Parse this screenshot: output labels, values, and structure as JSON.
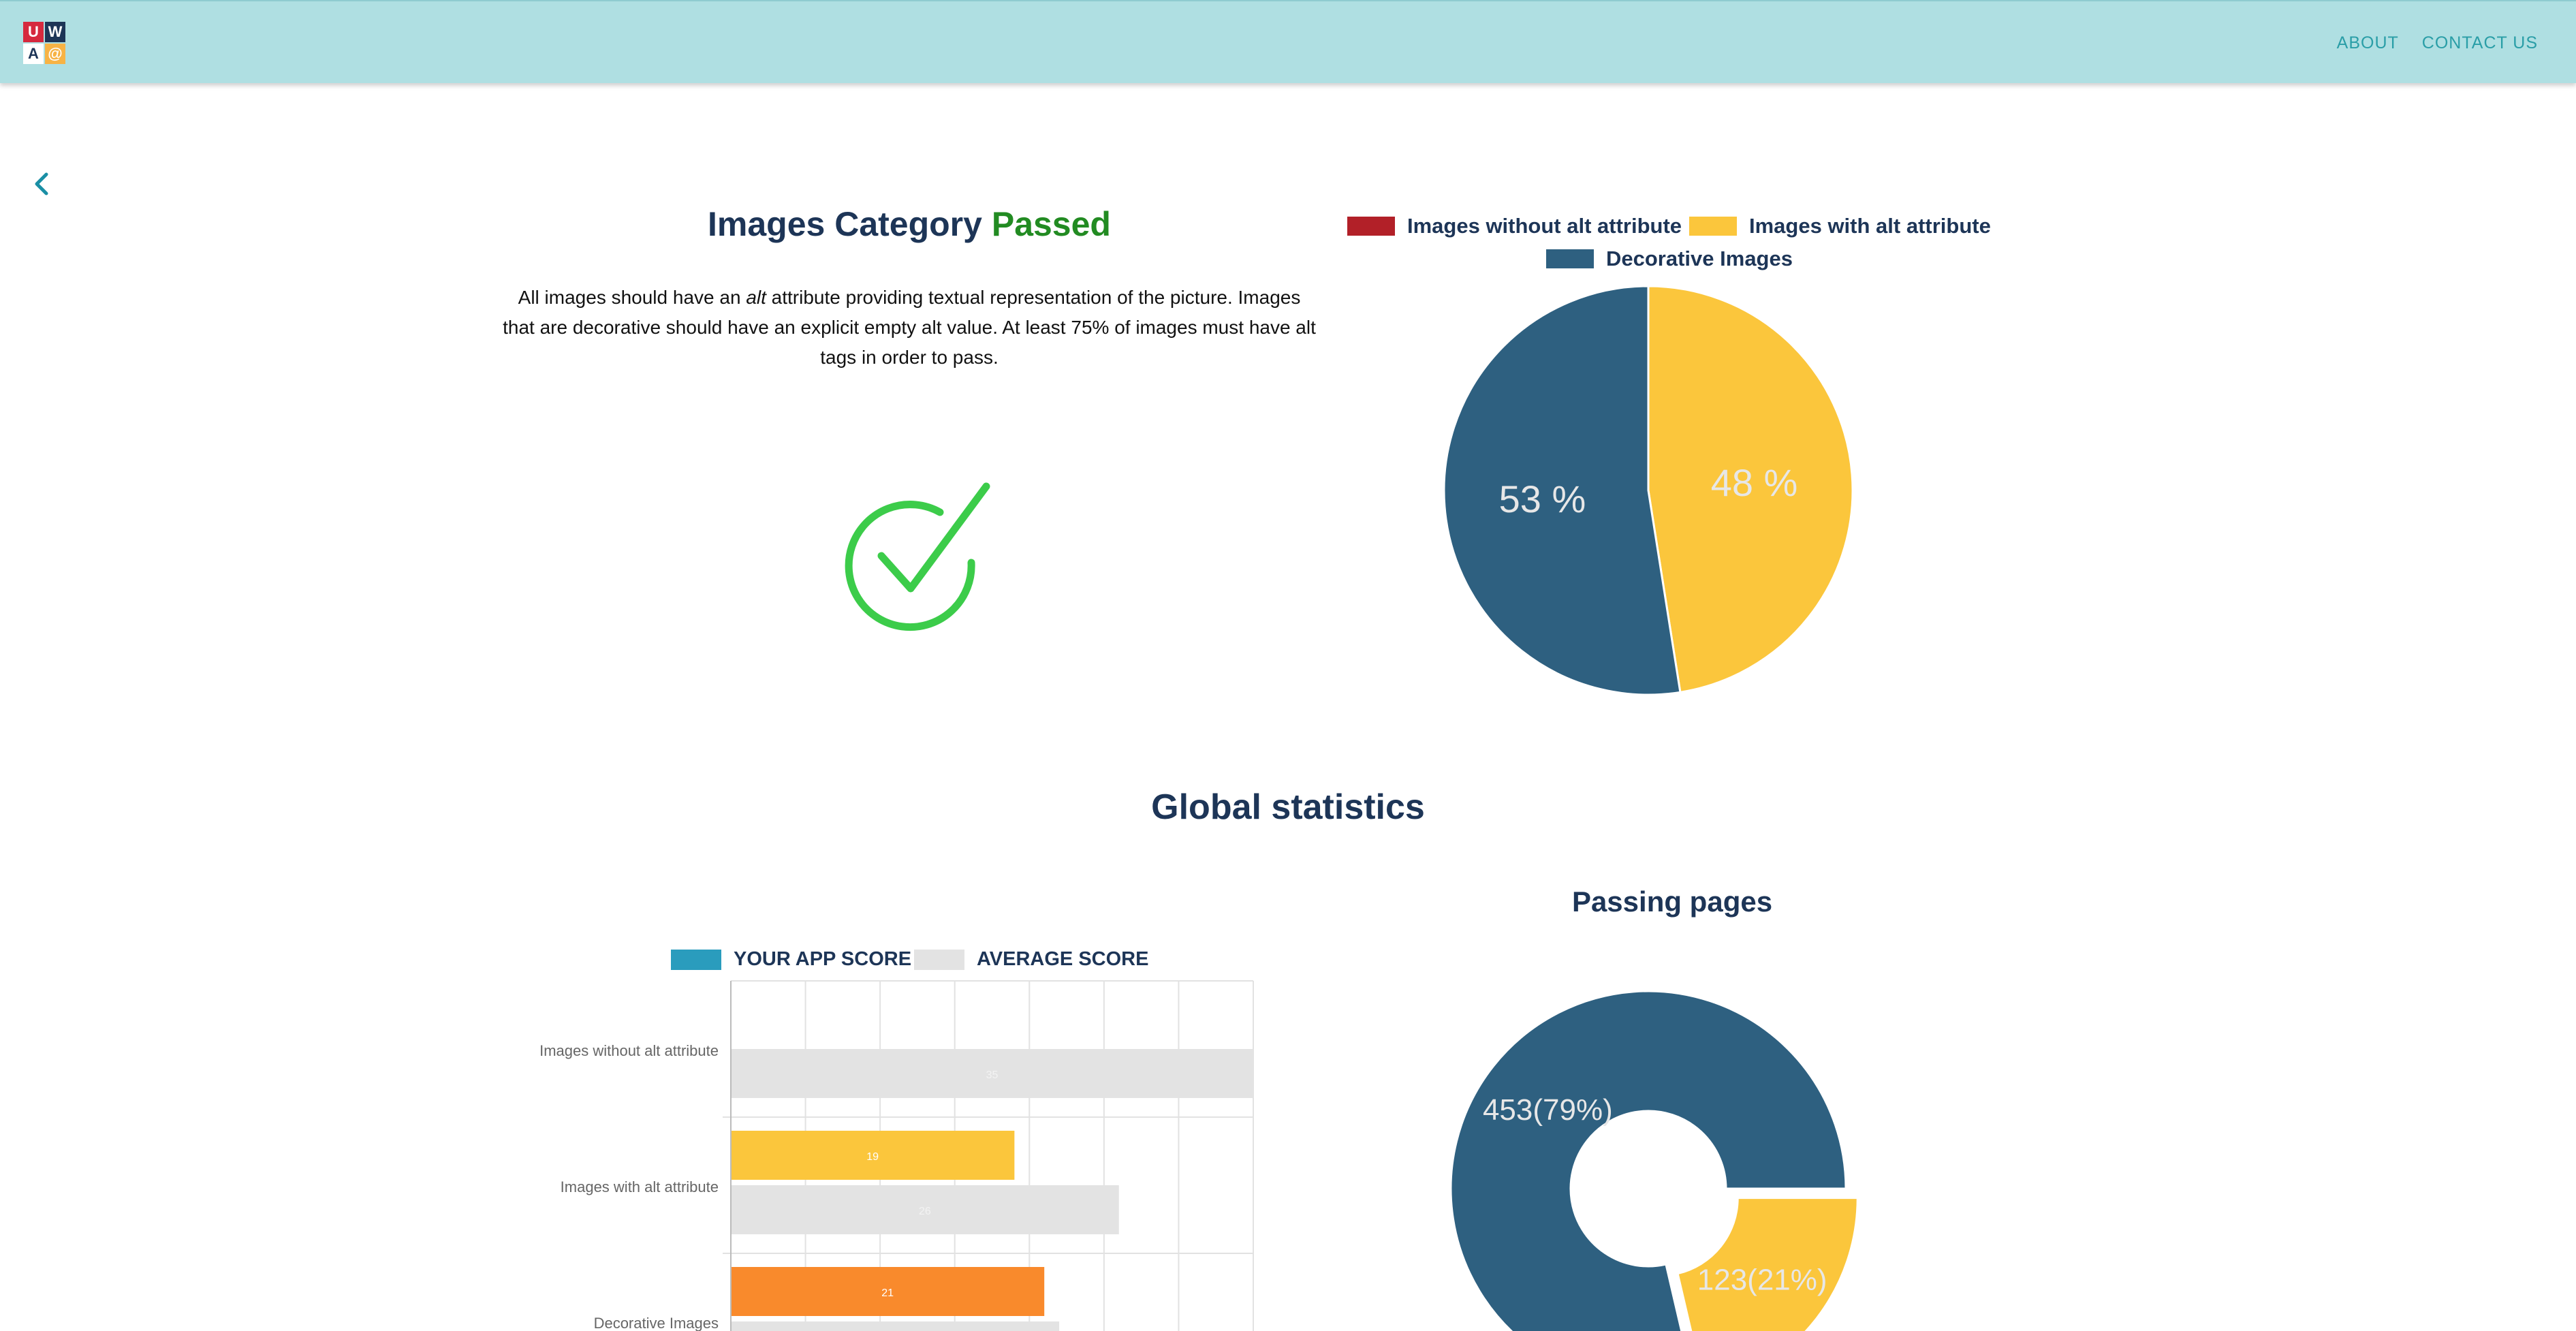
{
  "nav": {
    "about": "ABOUT",
    "contact": "CONTACT US"
  },
  "logo": {
    "letters": [
      "U",
      "W",
      "A",
      "@"
    ],
    "colors": [
      "#d6293e",
      "#1d3557",
      "#ffffff",
      "#f7b345"
    ]
  },
  "category": {
    "title_prefix": "Images Category ",
    "status": "Passed",
    "description_before_alt": "All images should have an ",
    "description_alt": "alt",
    "description_after_alt": " attribute providing textual representation of the picture. Images that are decorative should have an explicit empty alt value. At least 75% of images must have alt tags in order to pass."
  },
  "global": {
    "title": "Global statistics",
    "passing_pages_title": "Passing pages"
  },
  "chart_data": [
    {
      "type": "pie",
      "legend": [
        {
          "label": "Images without alt attribute",
          "color": "#b22028"
        },
        {
          "label": "Images with alt attribute",
          "color": "#fbc63c"
        },
        {
          "label": "Decorative Images",
          "color": "#2e6080"
        }
      ],
      "slices": [
        {
          "label": "Images without alt attribute",
          "value": 0,
          "color": "#b22028",
          "display": ""
        },
        {
          "label": "Images with alt attribute",
          "value": 47.5,
          "color": "#fbc63c",
          "display": "48 %"
        },
        {
          "label": "Decorative Images",
          "value": 52.5,
          "color": "#2e6080",
          "display": "53 %"
        }
      ]
    },
    {
      "type": "bar",
      "orientation": "horizontal",
      "legend": [
        {
          "label": "YOUR APP SCORE",
          "color": "#2a9cbd"
        },
        {
          "label": "AVERAGE SCORE",
          "color": "#e3e3e3"
        }
      ],
      "categories": [
        "Images without alt attribute",
        "Images with alt attribute",
        "Decorative Images"
      ],
      "series": [
        {
          "name": "YOUR APP SCORE",
          "values": [
            0,
            19,
            21
          ],
          "colors": [
            "#2a9cbd",
            "#fbc63c",
            "#f98a2c"
          ]
        },
        {
          "name": "AVERAGE SCORE",
          "values": [
            35,
            26,
            22
          ],
          "colors": [
            "#e3e3e3",
            "#e3e3e3",
            "#e3e3e3"
          ]
        }
      ],
      "xlim": [
        0,
        35
      ],
      "grid": true
    },
    {
      "type": "pie",
      "variant": "donut",
      "slices": [
        {
          "label": "",
          "value": 453,
          "color": "#2e6080",
          "display": "453(79%)"
        },
        {
          "label": "",
          "value": 123,
          "color": "#fbc63c",
          "display": "123(21%)"
        }
      ]
    }
  ]
}
